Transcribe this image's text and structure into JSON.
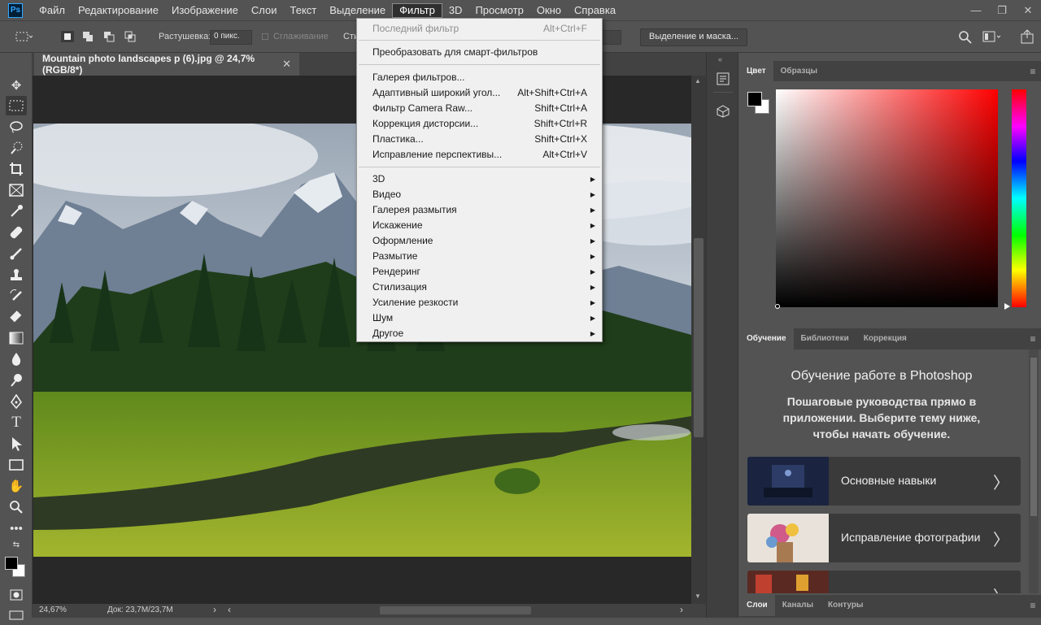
{
  "app": {
    "logo": "Ps"
  },
  "menubar": {
    "items": [
      "Файл",
      "Редактирование",
      "Изображение",
      "Слои",
      "Текст",
      "Выделение",
      "Фильтр",
      "3D",
      "Просмотр",
      "Окно",
      "Справка"
    ],
    "active": "Фильтр"
  },
  "window_controls": {
    "minimize": "—",
    "restore": "❐",
    "close": "✕"
  },
  "options": {
    "feather_label": "Растушевка:",
    "feather_value": "0 пикс.",
    "antialias_label": "Сглаживание",
    "style_label": "Сти",
    "select_mask_button": "Выделение и маска..."
  },
  "document": {
    "tab_title": "Mountain photo landscapes p (6).jpg @ 24,7% (RGB/8*)",
    "close": "✕",
    "zoom": "24,67%",
    "doc_size": "Док: 23,7M/23,7M",
    "status_arrow": "›",
    "scroll_left": "‹",
    "scroll_right": "›"
  },
  "filter_menu": {
    "last_filter": {
      "label": "Последний фильтр",
      "shortcut": "Alt+Ctrl+F"
    },
    "smart": {
      "label": "Преобразовать для смарт-фильтров"
    },
    "items": [
      {
        "label": "Галерея фильтров...",
        "shortcut": ""
      },
      {
        "label": "Адаптивный широкий угол...",
        "shortcut": "Alt+Shift+Ctrl+A"
      },
      {
        "label": "Фильтр Camera Raw...",
        "shortcut": "Shift+Ctrl+A"
      },
      {
        "label": "Коррекция дисторсии...",
        "shortcut": "Shift+Ctrl+R"
      },
      {
        "label": "Пластика...",
        "shortcut": "Shift+Ctrl+X"
      },
      {
        "label": "Исправление перспективы...",
        "shortcut": "Alt+Ctrl+V"
      }
    ],
    "submenus": [
      "3D",
      "Видео",
      "Галерея размытия",
      "Искажение",
      "Оформление",
      "Размытие",
      "Рендеринг",
      "Стилизация",
      "Усиление резкости",
      "Шум",
      "Другое"
    ]
  },
  "color_panel": {
    "tabs": [
      "Цвет",
      "Образцы"
    ],
    "menu": "≡"
  },
  "learn_panel": {
    "tabs": [
      "Обучение",
      "Библиотеки",
      "Коррекция"
    ],
    "menu": "≡",
    "title": "Обучение работе в Photoshop",
    "description": "Пошаговые руководства прямо в приложении. Выберите тему ниже, чтобы начать обучение.",
    "cards": [
      {
        "label": "Основные навыки",
        "arrow": "〉"
      },
      {
        "label": "Исправление фотографии",
        "arrow": "〉"
      },
      {
        "label": "",
        "arrow": "〉"
      }
    ]
  },
  "layers_panel": {
    "tabs": [
      "Слои",
      "Каналы",
      "Контуры"
    ],
    "menu": "≡"
  },
  "colors": {
    "accent": "#31a8ff",
    "menu_bg": "#f0f0f0",
    "ui_bg": "#535353"
  }
}
